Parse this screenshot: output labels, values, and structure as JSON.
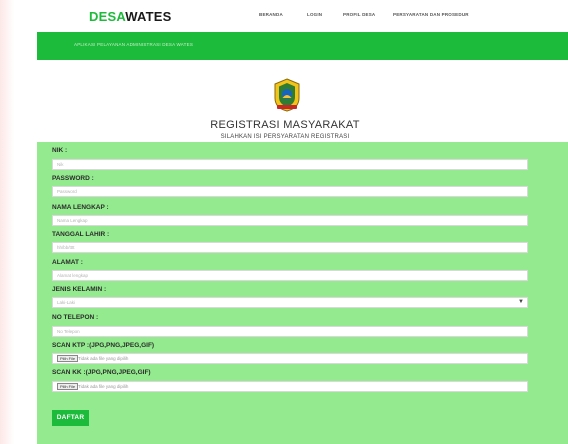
{
  "header": {
    "brand_prefix": "DESA",
    "brand_suffix": "WATES",
    "nav": [
      "BERANDA",
      "LOGIN",
      "PROFIL DESA",
      "PERSYARATAN DAN PROSEDUR"
    ]
  },
  "banner": {
    "tagline": "APLIKASI PELAYANAN ADMINISTRASI DESA WATES"
  },
  "form": {
    "title": "REGISTRASI MASYARAKAT",
    "subtitle": "SILAHKAN ISI PERSYARATAN REGISTRASI",
    "fields": {
      "nik": {
        "label": "NIK :",
        "placeholder": "Nik"
      },
      "password": {
        "label": "PASSWORD :",
        "placeholder": "Password"
      },
      "nama": {
        "label": "NAMA LENGKAP :",
        "placeholder": "Nama Lengkap"
      },
      "tanggal": {
        "label": "TANGGAL LAHIR :",
        "placeholder": "hh/bb/tttt"
      },
      "alamat": {
        "label": "ALAMAT :",
        "placeholder": "Alamat lengkap"
      },
      "jenis": {
        "label": "JENIS KELAMIN :",
        "selected": "Laki-Laki"
      },
      "telepon": {
        "label": "NO TELEPON :",
        "placeholder": "No Telepon"
      },
      "ktp": {
        "label": "SCAN KTP :(JPG,PNG,JPEG,GIF)",
        "button": "Pilih File",
        "status": "Tidak ada file yang dipilih"
      },
      "kk": {
        "label": "SCAN KK :(JPG,PNG,JPEG,GIF)",
        "button": "Pilih File",
        "status": "Tidak ada file yang dipilih"
      }
    },
    "submit": "DAFTAR"
  },
  "colors": {
    "accent": "#1dbb3b",
    "form_bg": "#94ea8f"
  }
}
